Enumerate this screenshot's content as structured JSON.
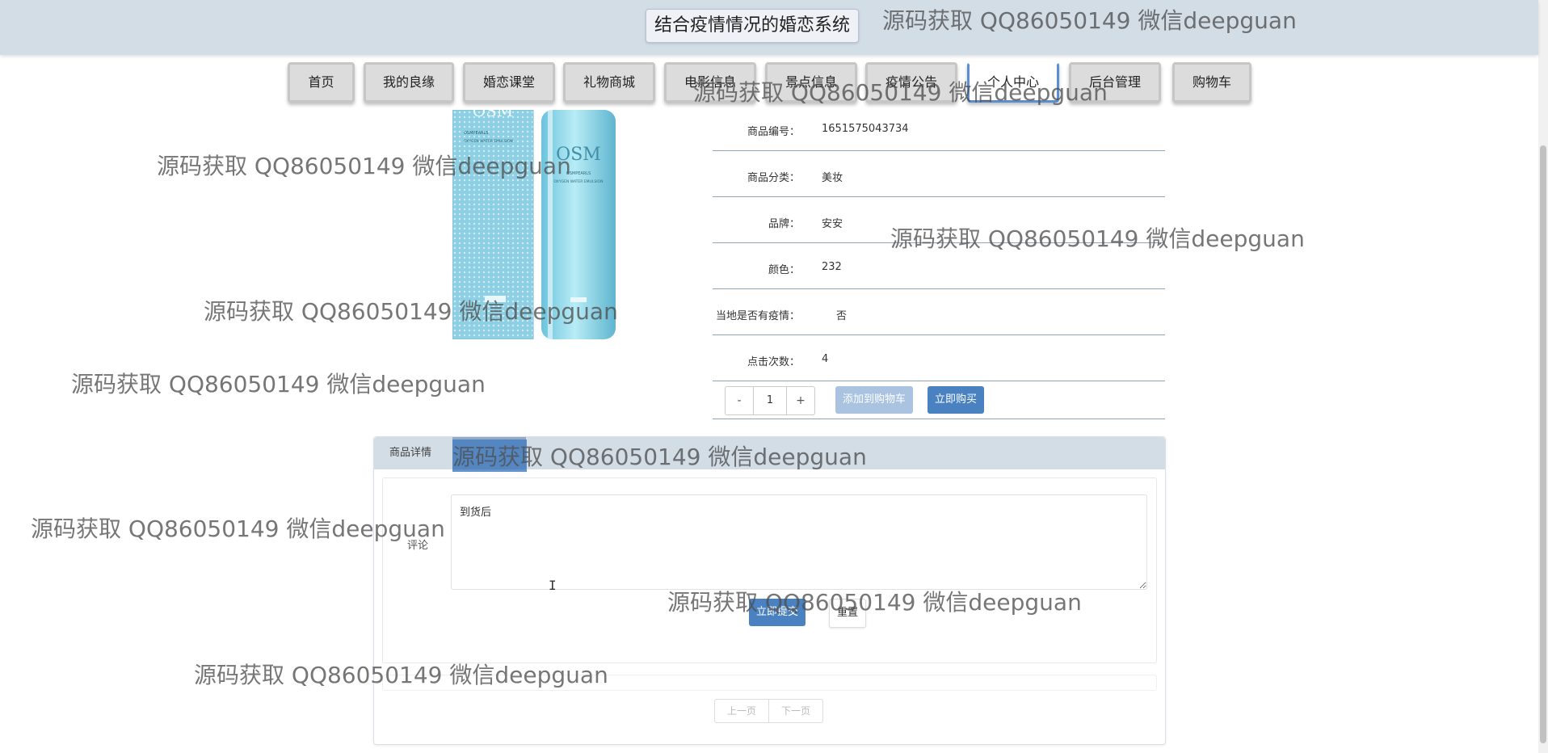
{
  "site": {
    "title": "结合疫情情况的婚恋系统"
  },
  "nav": {
    "items": [
      {
        "label": "首页"
      },
      {
        "label": "我的良缘"
      },
      {
        "label": "婚恋课堂"
      },
      {
        "label": "礼物商城"
      },
      {
        "label": "电影信息"
      },
      {
        "label": "景点信息"
      },
      {
        "label": "疫情公告"
      },
      {
        "label": "个人中心",
        "active": true
      },
      {
        "label": "后台管理"
      },
      {
        "label": "购物车"
      }
    ]
  },
  "product": {
    "image_text": {
      "brand": "OSM",
      "line1": "OSMPEARLS",
      "line2": "OXYGEN WATER EMULSION"
    },
    "fields": [
      {
        "label": "商品编号：",
        "value": "1651575043734"
      },
      {
        "label": "商品分类：",
        "value": "美妆"
      },
      {
        "label": "品牌：",
        "value": "安安"
      },
      {
        "label": "颜色：",
        "value": "232"
      },
      {
        "label": "当地是否有疫情：",
        "value": "否"
      },
      {
        "label": "点击次数：",
        "value": "4"
      }
    ],
    "quantity": {
      "minus": "-",
      "value": "1",
      "plus": "+"
    },
    "add_to_cart": "添加到购物车",
    "buy_now": "立即购买"
  },
  "tabs": {
    "details": "商品详情",
    "comments": "评论"
  },
  "comment_form": {
    "label": "评论",
    "text": "到货后",
    "submit": "立即提交",
    "reset": "重置"
  },
  "pager": {
    "prev": "上一页",
    "next": "下一页"
  },
  "watermark": {
    "text": "源码获取 QQ86050149 微信deepguan"
  },
  "colors": {
    "header_bg": "#d3dde6",
    "accent": "#4a81c1",
    "accent_light": "#a9c3e0",
    "tab_highlight": "#8fa9c6"
  }
}
